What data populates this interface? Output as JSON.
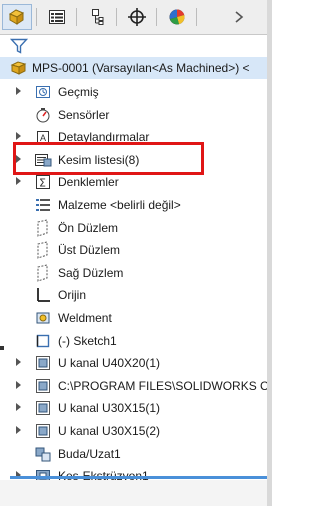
{
  "toolbar": {
    "tabs": [
      {
        "name": "feature-manager-tab-icon",
        "active": true
      },
      {
        "name": "property-manager-tab-icon",
        "active": false
      },
      {
        "name": "configuration-manager-tab-icon",
        "active": false
      },
      {
        "name": "dimxpert-manager-tab-icon",
        "active": false
      },
      {
        "name": "display-manager-tab-icon",
        "active": false
      }
    ]
  },
  "filter": {
    "icon": "filter-icon"
  },
  "tree": {
    "root": {
      "label": "MPS-0001 (Varsayılan<As Machined>) <",
      "icon": "part-icon"
    },
    "items": [
      {
        "label": "Geçmiş",
        "icon": "history-icon",
        "expandable": true
      },
      {
        "label": "Sensörler",
        "icon": "sensor-icon",
        "expandable": false
      },
      {
        "label": "Detaylandırmalar",
        "icon": "annotations-icon",
        "expandable": true
      },
      {
        "label": "Kesim listesi(8)",
        "icon": "cut-list-icon",
        "expandable": true
      },
      {
        "label": "Denklemler",
        "icon": "equations-icon",
        "expandable": true
      },
      {
        "label": "Malzeme <belirli değil>",
        "icon": "material-icon",
        "expandable": false
      },
      {
        "label": "Ön Düzlem",
        "icon": "plane-icon",
        "expandable": false
      },
      {
        "label": "Üst Düzlem",
        "icon": "plane-icon",
        "expandable": false
      },
      {
        "label": "Sağ Düzlem",
        "icon": "plane-icon",
        "expandable": false
      },
      {
        "label": "Orijin",
        "icon": "origin-icon",
        "expandable": false
      },
      {
        "label": "Weldment",
        "icon": "weldment-icon",
        "expandable": false
      },
      {
        "label": "(-) Sketch1",
        "icon": "sketch-icon",
        "expandable": false
      },
      {
        "label": "U kanal U40X20(1)",
        "icon": "structural-member-icon",
        "expandable": true
      },
      {
        "label": "C:\\PROGRAM FILES\\SOLIDWORKS C",
        "icon": "structural-member-icon",
        "expandable": true
      },
      {
        "label": "U kanal U30X15(1)",
        "icon": "structural-member-icon",
        "expandable": true
      },
      {
        "label": "U kanal U30X15(2)",
        "icon": "structural-member-icon",
        "expandable": true
      },
      {
        "label": "Buda/Uzat1",
        "icon": "trim-extend-icon",
        "expandable": false
      },
      {
        "label": "Kes-Ekstrüzyon1",
        "icon": "cut-extrude-icon",
        "expandable": true
      }
    ]
  },
  "colors": {
    "highlight": "#e01616",
    "selection": "#d7e7f8",
    "accent": "#4a90d9"
  }
}
